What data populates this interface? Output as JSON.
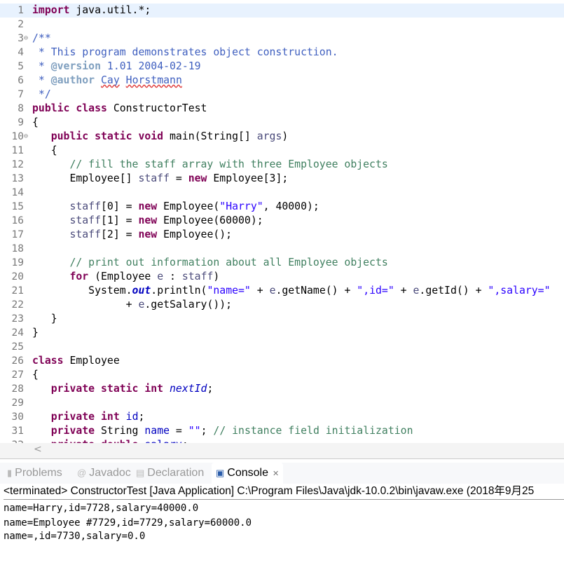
{
  "editor": {
    "lines": [
      [
        [
          "k",
          "import"
        ],
        [
          "p",
          " java.util.*;"
        ]
      ],
      [],
      [
        [
          "d",
          "/**"
        ]
      ],
      [
        [
          "d",
          " * This program demonstrates object construction."
        ]
      ],
      [
        [
          "d",
          " * "
        ],
        [
          "t",
          "@version"
        ],
        [
          "d",
          " 1.01 2004-02-19"
        ]
      ],
      [
        [
          "d",
          " * "
        ],
        [
          "t",
          "@author"
        ],
        [
          "d",
          " "
        ],
        [
          "dsq",
          "Cay"
        ],
        [
          "d",
          " "
        ],
        [
          "dsq",
          "Horstmann"
        ]
      ],
      [
        [
          "d",
          " */"
        ]
      ],
      [
        [
          "k",
          "public class"
        ],
        [
          "p",
          " ConstructorTest"
        ]
      ],
      [
        [
          "p",
          "{"
        ]
      ],
      [
        [
          "p",
          "   "
        ],
        [
          "k",
          "public static void"
        ],
        [
          "p",
          " main(String[] "
        ],
        [
          "v",
          "args"
        ],
        [
          "p",
          ")"
        ]
      ],
      [
        [
          "p",
          "   {"
        ]
      ],
      [
        [
          "c",
          "      // fill the staff array with three Employee objects"
        ]
      ],
      [
        [
          "p",
          "      Employee[] "
        ],
        [
          "v",
          "staff"
        ],
        [
          "p",
          " = "
        ],
        [
          "k",
          "new"
        ],
        [
          "p",
          " Employee[3];"
        ]
      ],
      [],
      [
        [
          "p",
          "      "
        ],
        [
          "v",
          "staff"
        ],
        [
          "p",
          "[0] = "
        ],
        [
          "k",
          "new"
        ],
        [
          "p",
          " Employee("
        ],
        [
          "s",
          "\"Harry\""
        ],
        [
          "p",
          ", 40000);"
        ]
      ],
      [
        [
          "p",
          "      "
        ],
        [
          "v",
          "staff"
        ],
        [
          "p",
          "[1] = "
        ],
        [
          "k",
          "new"
        ],
        [
          "p",
          " Employee(60000);"
        ]
      ],
      [
        [
          "p",
          "      "
        ],
        [
          "v",
          "staff"
        ],
        [
          "p",
          "[2] = "
        ],
        [
          "k",
          "new"
        ],
        [
          "p",
          " Employee();"
        ]
      ],
      [],
      [
        [
          "c",
          "      // print out information about all Employee objects"
        ]
      ],
      [
        [
          "p",
          "      "
        ],
        [
          "k",
          "for"
        ],
        [
          "p",
          " (Employee "
        ],
        [
          "v",
          "e"
        ],
        [
          "p",
          " : "
        ],
        [
          "v",
          "staff"
        ],
        [
          "p",
          ")"
        ]
      ],
      [
        [
          "p",
          "         System."
        ],
        [
          "bf",
          "out"
        ],
        [
          "p",
          ".println("
        ],
        [
          "s",
          "\"name=\""
        ],
        [
          "p",
          " + "
        ],
        [
          "v",
          "e"
        ],
        [
          "p",
          ".getName() + "
        ],
        [
          "s",
          "\",id=\""
        ],
        [
          "p",
          " + "
        ],
        [
          "v",
          "e"
        ],
        [
          "p",
          ".getId() + "
        ],
        [
          "s",
          "\",salary=\""
        ]
      ],
      [
        [
          "p",
          "               + "
        ],
        [
          "v",
          "e"
        ],
        [
          "p",
          ".getSalary());"
        ]
      ],
      [
        [
          "p",
          "   }"
        ]
      ],
      [
        [
          "p",
          "}"
        ]
      ],
      [],
      [
        [
          "k",
          "class"
        ],
        [
          "p",
          " Employee"
        ]
      ],
      [
        [
          "p",
          "{"
        ]
      ],
      [
        [
          "p",
          "   "
        ],
        [
          "k",
          "private static int"
        ],
        [
          "p",
          " "
        ],
        [
          "st",
          "nextId"
        ],
        [
          "p",
          ";"
        ]
      ],
      [],
      [
        [
          "p",
          "   "
        ],
        [
          "k",
          "private int"
        ],
        [
          "p",
          " "
        ],
        [
          "f",
          "id"
        ],
        [
          "p",
          ";"
        ]
      ],
      [
        [
          "p",
          "   "
        ],
        [
          "k",
          "private"
        ],
        [
          "p",
          " String "
        ],
        [
          "f",
          "name"
        ],
        [
          "p",
          " = "
        ],
        [
          "s",
          "\"\""
        ],
        [
          "p",
          "; "
        ],
        [
          "c",
          "// instance field initialization"
        ]
      ],
      [
        [
          "p",
          "   "
        ],
        [
          "k",
          "private double"
        ],
        [
          "p",
          " "
        ],
        [
          "f",
          "salary"
        ],
        [
          "p",
          ";"
        ]
      ]
    ],
    "folds": [
      3,
      10
    ],
    "scroll_left": "<"
  },
  "tabs": [
    {
      "label": "Problems",
      "icon": "problems-icon",
      "glyph": "▮"
    },
    {
      "label": "Javadoc",
      "icon": "javadoc-icon",
      "glyph": "@"
    },
    {
      "label": "Declaration",
      "icon": "declaration-icon",
      "glyph": "▤"
    },
    {
      "label": "Console",
      "icon": "console-icon",
      "glyph": "▣",
      "active": true,
      "close": "✕"
    }
  ],
  "console": {
    "header": "<terminated> ConstructorTest [Java Application] C:\\Program Files\\Java\\jdk-10.0.2\\bin\\javaw.exe (2018年9月25",
    "output": [
      "name=Harry,id=7728,salary=40000.0",
      "name=Employee #7729,id=7729,salary=60000.0",
      "name=,id=7730,salary=0.0"
    ]
  }
}
